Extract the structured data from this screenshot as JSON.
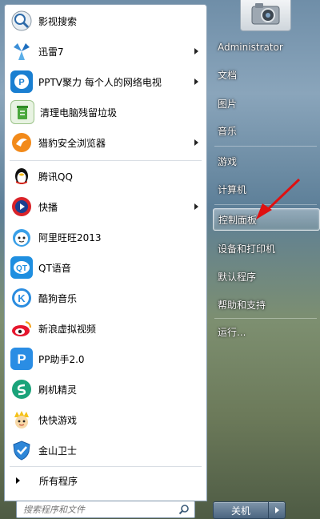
{
  "start_menu": {
    "programs": [
      {
        "label": "影视搜索",
        "icon": "video-search-icon"
      },
      {
        "label": "迅雷7",
        "icon": "thunder-icon",
        "submenu": true
      },
      {
        "label": "PPTV聚力 每个人的网络电视",
        "icon": "pptv-icon",
        "submenu": true
      },
      {
        "label": "清理电脑残留垃圾",
        "icon": "recycle-icon"
      },
      {
        "label": "猎豹安全浏览器",
        "icon": "cheetah-browser-icon",
        "submenu": true
      },
      {
        "label": "腾讯QQ",
        "icon": "qq-penguin-icon"
      },
      {
        "label": "快播",
        "icon": "qvod-icon",
        "submenu": true
      },
      {
        "label": "阿里旺旺2013",
        "icon": "aliwangwang-icon"
      },
      {
        "label": "QT语音",
        "icon": "qt-voice-icon"
      },
      {
        "label": "酷狗音乐",
        "icon": "kugou-icon"
      },
      {
        "label": "新浪虚拟视频",
        "icon": "sina-eye-icon"
      },
      {
        "label": "PP助手2.0",
        "icon": "pp-assistant-icon"
      },
      {
        "label": "刷机精灵",
        "icon": "shuaji-icon"
      },
      {
        "label": "快快游戏",
        "icon": "kuaikuai-game-icon"
      },
      {
        "label": "金山卫士",
        "icon": "kingsoft-shield-icon"
      }
    ],
    "all_programs_label": "所有程序",
    "search_placeholder": "搜索程序和文件",
    "right_items": [
      {
        "label": "Administrator"
      },
      {
        "label": "文档"
      },
      {
        "label": "图片"
      },
      {
        "label": "音乐"
      },
      {
        "label": "游戏"
      },
      {
        "label": "计算机"
      },
      {
        "label": "控制面板",
        "highlighted": true
      },
      {
        "label": "设备和打印机"
      },
      {
        "label": "默认程序"
      },
      {
        "label": "帮助和支持"
      },
      {
        "label": "运行..."
      }
    ],
    "shutdown_label": "关机"
  }
}
